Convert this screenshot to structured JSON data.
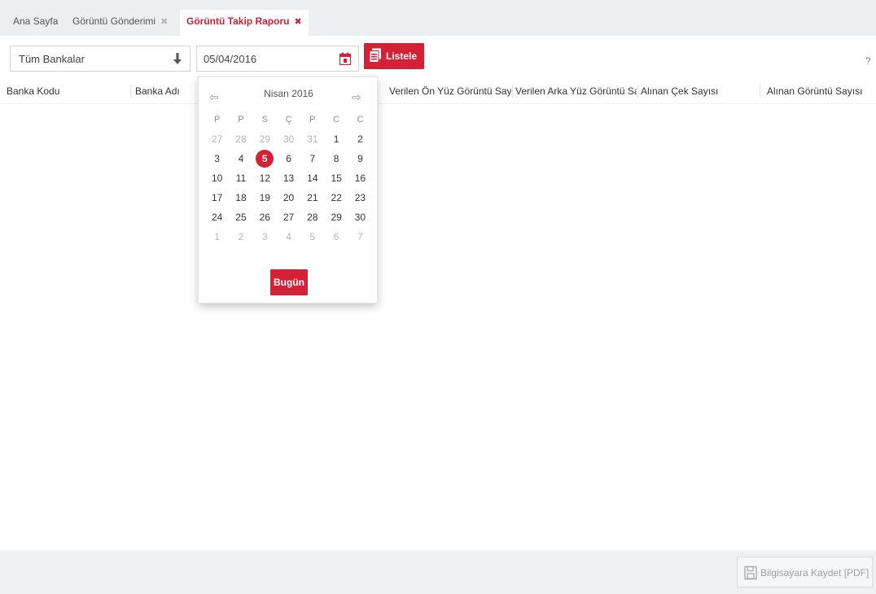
{
  "tabs": [
    {
      "label": "Ana Sayfa",
      "closable": false,
      "active": false
    },
    {
      "label": "Görüntü Gönderimi",
      "closable": true,
      "active": false
    },
    {
      "label": "Görüntü Takip Raporu",
      "closable": true,
      "active": true
    }
  ],
  "tab_close_glyph": "✖",
  "toolbar": {
    "bank_select_value": "Tüm Bankalar",
    "date_value": "05/04/2016",
    "list_button_label": "Listele",
    "help_label": "?"
  },
  "table": {
    "columns": [
      "Banka Kodu",
      "Banka Adı",
      "Verilen Ön Yüz Görüntü Sayısı",
      "Verilen Arka Yüz Görüntü Sayısı",
      "Alınan Çek Sayısı",
      "Alınan Görüntü Sayısı"
    ],
    "rows": []
  },
  "datepicker": {
    "month_title": "Nisan 2016",
    "prev_glyph": "⇦",
    "next_glyph": "⇨",
    "weekdays": [
      "P",
      "P",
      "S",
      "Ç",
      "P",
      "C",
      "C"
    ],
    "weeks": [
      [
        [
          "27",
          1
        ],
        [
          "28",
          1
        ],
        [
          "29",
          1
        ],
        [
          "30",
          1
        ],
        [
          "31",
          1
        ],
        [
          "1",
          0
        ],
        [
          "2",
          0
        ]
      ],
      [
        [
          "3",
          0
        ],
        [
          "4",
          0
        ],
        [
          "5",
          2
        ],
        [
          "6",
          0
        ],
        [
          "7",
          0
        ],
        [
          "8",
          0
        ],
        [
          "9",
          0
        ]
      ],
      [
        [
          "10",
          0
        ],
        [
          "11",
          0
        ],
        [
          "12",
          0
        ],
        [
          "13",
          0
        ],
        [
          "14",
          0
        ],
        [
          "15",
          0
        ],
        [
          "16",
          0
        ]
      ],
      [
        [
          "17",
          0
        ],
        [
          "18",
          0
        ],
        [
          "19",
          0
        ],
        [
          "20",
          0
        ],
        [
          "21",
          0
        ],
        [
          "22",
          0
        ],
        [
          "23",
          0
        ]
      ],
      [
        [
          "24",
          0
        ],
        [
          "25",
          0
        ],
        [
          "26",
          0
        ],
        [
          "27",
          0
        ],
        [
          "28",
          0
        ],
        [
          "29",
          0
        ],
        [
          "30",
          0
        ]
      ],
      [
        [
          "1",
          1
        ],
        [
          "2",
          1
        ],
        [
          "3",
          1
        ],
        [
          "4",
          1
        ],
        [
          "5",
          1
        ],
        [
          "6",
          1
        ],
        [
          "7",
          1
        ]
      ]
    ],
    "day_state_legend": {
      "0": "current-month",
      "1": "other-month",
      "2": "selected"
    },
    "today_button_label": "Bugün"
  },
  "footer": {
    "save_button_label": "Bilgisayara Kaydet [PDF]"
  },
  "colors": {
    "accent": "#d42136",
    "tabbar_bg": "#eceef1",
    "footer_bg": "#eff0f2"
  }
}
